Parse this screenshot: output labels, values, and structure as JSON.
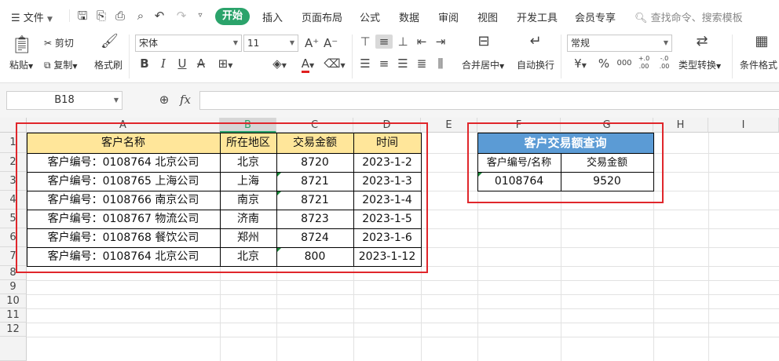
{
  "menu": {
    "file_label": "文件",
    "tabs": [
      "开始",
      "插入",
      "页面布局",
      "公式",
      "数据",
      "审阅",
      "视图",
      "开发工具",
      "会员专享"
    ],
    "search_placeholder": "查找命令、搜索模板"
  },
  "ribbon": {
    "paste": "粘贴",
    "cut": "剪切",
    "copy": "复制",
    "format_painter": "格式刷",
    "font_name": "宋体",
    "font_size": "11",
    "number_format": "常规",
    "merge_center": "合并居中",
    "wrap_text": "自动换行",
    "type_convert": "类型转换",
    "conditional_format": "条件格式",
    "percent": "%",
    "thousands": "000",
    "dec_inc": "+.0 .00",
    "dec_dec": "-.0 .00"
  },
  "formula_bar": {
    "name_box": "B18",
    "fx": "fx"
  },
  "sheet": {
    "columns": [
      "A",
      "B",
      "C",
      "D",
      "E",
      "F",
      "G",
      "H",
      "I"
    ],
    "rows": [
      "1",
      "2",
      "3",
      "4",
      "5",
      "6",
      "7",
      "8",
      "9",
      "10",
      "11",
      "12"
    ],
    "table_header": [
      "客户名称",
      "所在地区",
      "交易金额",
      "时间"
    ],
    "table_rows": [
      [
        "客户编号：0108764 北京公司",
        "北京",
        "8720",
        "2023-1-2"
      ],
      [
        "客户编号：0108765 上海公司",
        "上海",
        "8721",
        "2023-1-3"
      ],
      [
        "客户编号：0108766 南京公司",
        "南京",
        "8721",
        "2023-1-4"
      ],
      [
        "客户编号：0108767 物流公司",
        "济南",
        "8723",
        "2023-1-5"
      ],
      [
        "客户编号：0108768 餐饮公司",
        "郑州",
        "8724",
        "2023-1-6"
      ],
      [
        "客户编号：0108764 北京公司",
        "北京",
        "800",
        "2023-1-12"
      ]
    ],
    "lookup_title": "客户交易额查询",
    "lookup_header": [
      "客户编号/名称",
      "交易金额"
    ],
    "lookup_row": [
      "0108764",
      "9520"
    ]
  },
  "colors": {
    "accent_tab": "#2ba36b",
    "header_fill": "#ffe69a",
    "lookup_title_fill": "#5b9bd5",
    "annotation_red": "#e0262b"
  }
}
